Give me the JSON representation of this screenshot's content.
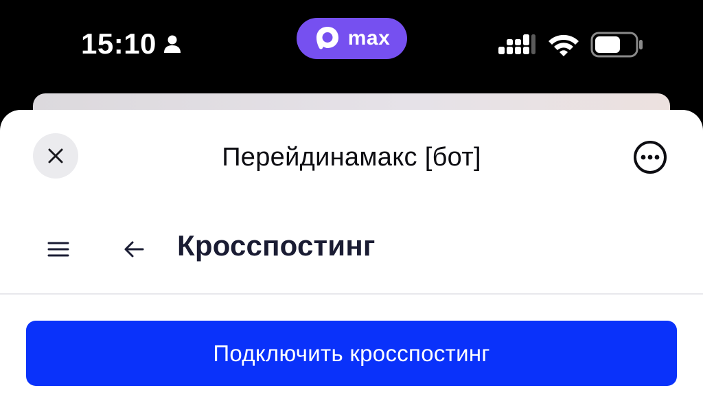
{
  "status_bar": {
    "time": "15:10",
    "island_label": "max",
    "island_color": "#7650f0"
  },
  "sheet": {
    "title": "Перейдинамакс [бот]"
  },
  "page": {
    "title": "Кросспостинг",
    "connect_button_label": "Подключить кросспостинг",
    "accent_color": "#0a32fa"
  },
  "icons": {
    "close": "close-icon",
    "more": "more-icon",
    "menu": "menu-icon",
    "back": "back-arrow-icon",
    "person": "person-icon",
    "signal": "cellular-signal-icon",
    "wifi": "wifi-icon",
    "battery": "battery-icon"
  }
}
